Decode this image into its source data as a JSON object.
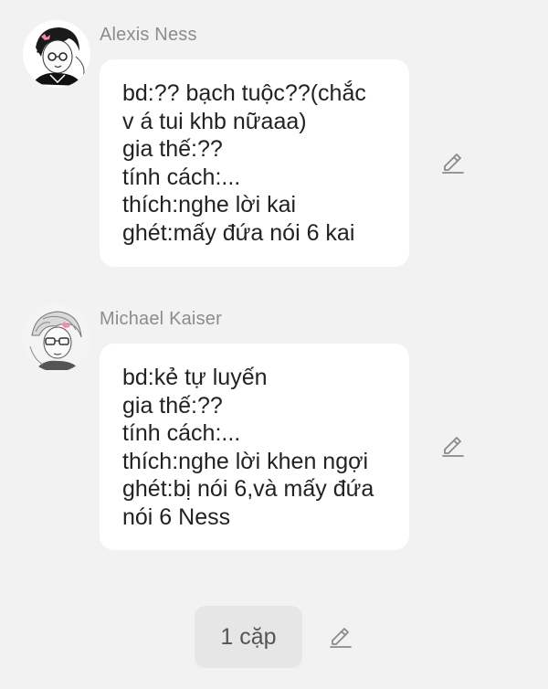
{
  "messages": [
    {
      "name": "Alexis Ness",
      "avatar_icon": "anime-boy-avatar-icon",
      "lines": [
        "bd:?? bạch tuộc??(chắc",
        "v á tui khb nữaaa)",
        "gia thế:??",
        "tính cách:...",
        "thích:nghe lời kai",
        "ghét:mấy đứa nói 6 kai"
      ]
    },
    {
      "name": "Michael Kaiser",
      "avatar_icon": "anime-boy-glasses-avatar-icon",
      "lines": [
        "bd:kẻ tự luyến",
        "gia thế:??",
        "tính cách:...",
        "thích:nghe lời khen ngợi",
        "ghét:bị nói 6,và mấy đứa",
        "nói 6 Ness"
      ]
    }
  ],
  "footer": {
    "pair_label": "1 cặp"
  },
  "icons": {
    "edit": "pencil-edit-icon"
  },
  "colors": {
    "background": "#f2f2f2",
    "bubble": "#ffffff",
    "name_text": "#8c8c8c",
    "body_text": "#222222",
    "button_bg": "#e6e6e6"
  }
}
